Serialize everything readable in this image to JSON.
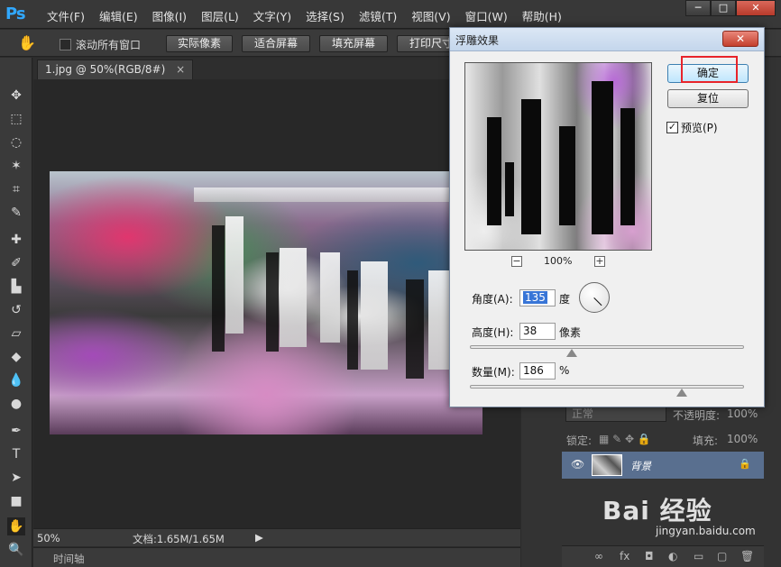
{
  "app": {
    "logo": "Ps",
    "menu": [
      "文件(F)",
      "编辑(E)",
      "图像(I)",
      "图层(L)",
      "文字(Y)",
      "选择(S)",
      "滤镜(T)",
      "视图(V)",
      "窗口(W)",
      "帮助(H)"
    ],
    "window_controls": {
      "minimize": "─",
      "maximize": "□",
      "close": "✕"
    }
  },
  "options_bar": {
    "scroll_all_label": "滚动所有窗口",
    "buttons": [
      "实际像素",
      "适合屏幕",
      "填充屏幕",
      "打印尺寸"
    ]
  },
  "document": {
    "tab_title": "1.jpg @ 50%(RGB/8#)",
    "tab_close": "×"
  },
  "status": {
    "zoom": "50%",
    "doc_size": "文档:1.65M/1.65M",
    "arrow": "▶"
  },
  "timeline": {
    "label": "时间轴"
  },
  "layers_panel": {
    "blend_mode": "正常",
    "opacity_label": "不透明度:",
    "opacity_value": "100%",
    "lock_label": "锁定:",
    "fill_label": "填充:",
    "fill_value": "100%",
    "layer_name": "背景",
    "bottom_icons": [
      "∞",
      "fx",
      "◘",
      "◐",
      "▭",
      "▢",
      "🗑"
    ]
  },
  "dialog": {
    "title": "浮雕效果",
    "close": "✕",
    "ok_label": "确定",
    "reset_label": "复位",
    "preview_label": "预览(P)",
    "preview_checked": "✓",
    "zoom_out": "−",
    "zoom_in": "+",
    "zoom_level": "100%",
    "angle_label": "角度(A):",
    "angle_value": "135",
    "angle_unit": "度",
    "height_label": "高度(H):",
    "height_value": "38",
    "height_unit": "像素",
    "amount_label": "数量(M):",
    "amount_value": "186",
    "amount_unit": "%",
    "height_slider_fraction": 0.37,
    "amount_slider_fraction": 0.77,
    "highlight_color": "#e8242a"
  },
  "watermark": {
    "text": "Bai 经验",
    "sub": "jingyan.baidu.com"
  }
}
